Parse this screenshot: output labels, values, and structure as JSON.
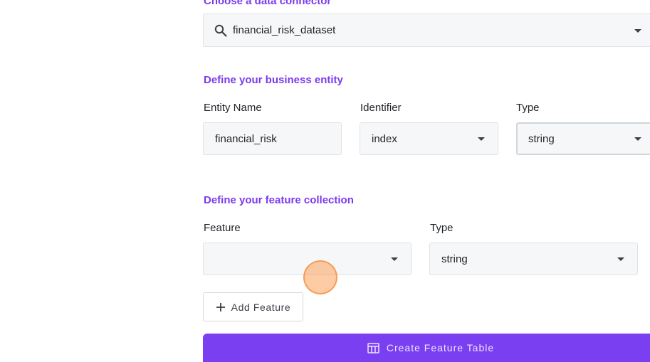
{
  "connector": {
    "section_title": "Choose a data connector",
    "search_value": "financial_risk_dataset"
  },
  "entity": {
    "section_title": "Define your business entity",
    "name_label": "Entity Name",
    "name_value": "financial_risk",
    "identifier_label": "Identifier",
    "identifier_value": "index",
    "type_label": "Type",
    "type_value": "string"
  },
  "features": {
    "section_title": "Define your feature collection",
    "feature_label": "Feature",
    "feature_value": "",
    "type_label": "Type",
    "type_value": "string",
    "add_button_label": "Add Feature"
  },
  "actions": {
    "create_button_label": "Create Feature Table"
  },
  "colors": {
    "accent": "#7c3aed",
    "primary_button": "#7b3ff2",
    "field_background": "#f6f7f8",
    "cursor_highlight": "#fba05a"
  },
  "icons": {
    "search": "search-icon",
    "dropdown": "chevron-down-icon",
    "add": "plus-icon",
    "table": "table-icon"
  }
}
